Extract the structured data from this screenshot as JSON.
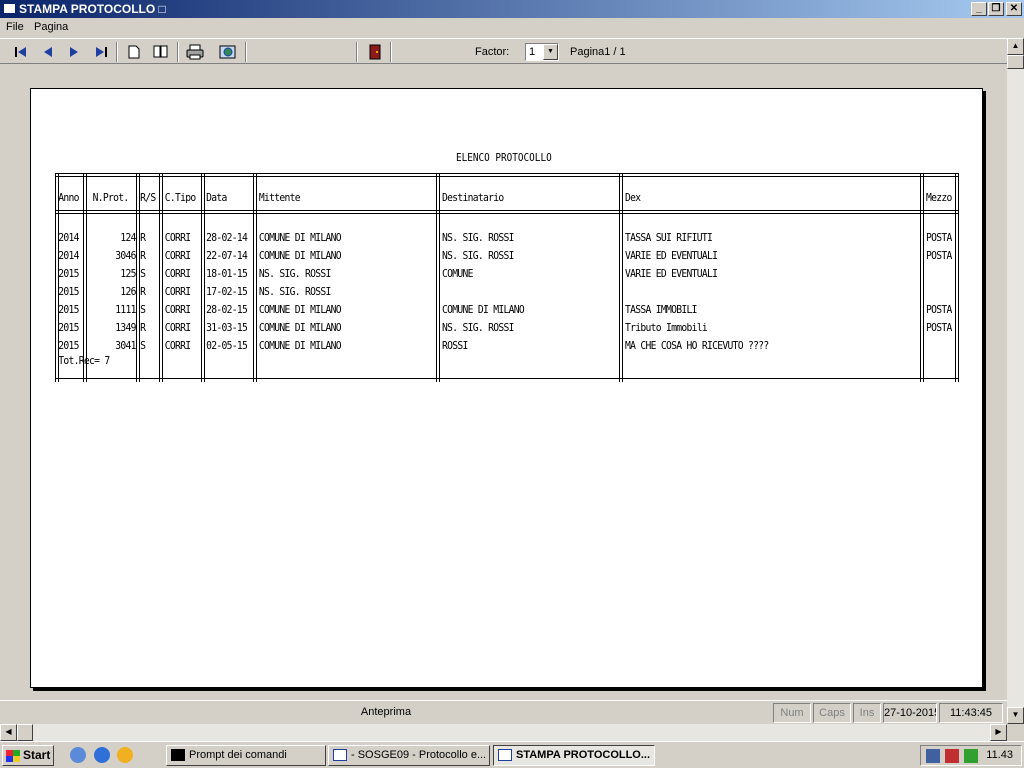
{
  "window": {
    "title": "STAMPA PROTOCOLLO □"
  },
  "menu": [
    "File",
    "Pagina"
  ],
  "toolbar": {
    "icons": [
      "first-page-icon",
      "prev-page-icon",
      "next-page-icon",
      "last-page-icon",
      "single-page-icon",
      "two-pages-icon",
      "print-icon",
      "export-icon",
      "exit-door-icon"
    ],
    "factor_label": "Factor:",
    "factor_value": "1",
    "page_label": "Pagina1 / 1"
  },
  "report": {
    "title": "ELENCO PROTOCOLLO",
    "columns": [
      "Anno",
      "N.Prot.",
      "R/S",
      "C.Tipo",
      "Data",
      "Mittente",
      "Destinatario",
      "Dex",
      "Mezzo"
    ],
    "rows": [
      [
        "2014",
        "124",
        "R",
        "CORRI",
        "28-02-14",
        "COMUNE DI MILANO",
        "NS. SIG. ROSSI",
        "TASSA SUI RIFIUTI",
        "POSTA"
      ],
      [
        "2014",
        "3046",
        "R",
        "CORRI",
        "22-07-14",
        "COMUNE DI MILANO",
        "NS. SIG. ROSSI",
        "VARIE ED EVENTUALI",
        "POSTA"
      ],
      [
        "2015",
        "125",
        "S",
        "CORRI",
        "18-01-15",
        "NS. SIG. ROSSI",
        "COMUNE",
        "VARIE ED EVENTUALI",
        ""
      ],
      [
        "2015",
        "126",
        "R",
        "CORRI",
        "17-02-15",
        "NS. SIG. ROSSI",
        "",
        "",
        ""
      ],
      [
        "2015",
        "1111",
        "S",
        "CORRI",
        "28-02-15",
        "COMUNE DI MILANO",
        "COMUNE DI MILANO",
        "TASSA IMMOBILI",
        "POSTA"
      ],
      [
        "2015",
        "1349",
        "R",
        "CORRI",
        "31-03-15",
        "COMUNE DI MILANO",
        "NS. SIG. ROSSI",
        "Tributo Immobili",
        "POSTA"
      ],
      [
        "2015",
        "3041",
        "S",
        "CORRI",
        "02-05-15",
        "COMUNE DI MILANO",
        "ROSSI",
        "MA CHE COSA HO RICEVUTO ????",
        ""
      ]
    ],
    "total": "Tot.Rec= 7"
  },
  "status": {
    "main": "Anteprima",
    "num": "Num",
    "caps": "Caps",
    "ins": "Ins",
    "date": "27-10-2015",
    "time": "11:43:45"
  },
  "taskbar": {
    "start": "Start",
    "tasks": [
      "Prompt dei comandi",
      "- SOSGE09 - Protocollo e...",
      "STAMPA PROTOCOLLO..."
    ],
    "clock": "11.43"
  },
  "colors": {
    "titlebar": "#0a246a",
    "face": "#d4d0c8"
  }
}
